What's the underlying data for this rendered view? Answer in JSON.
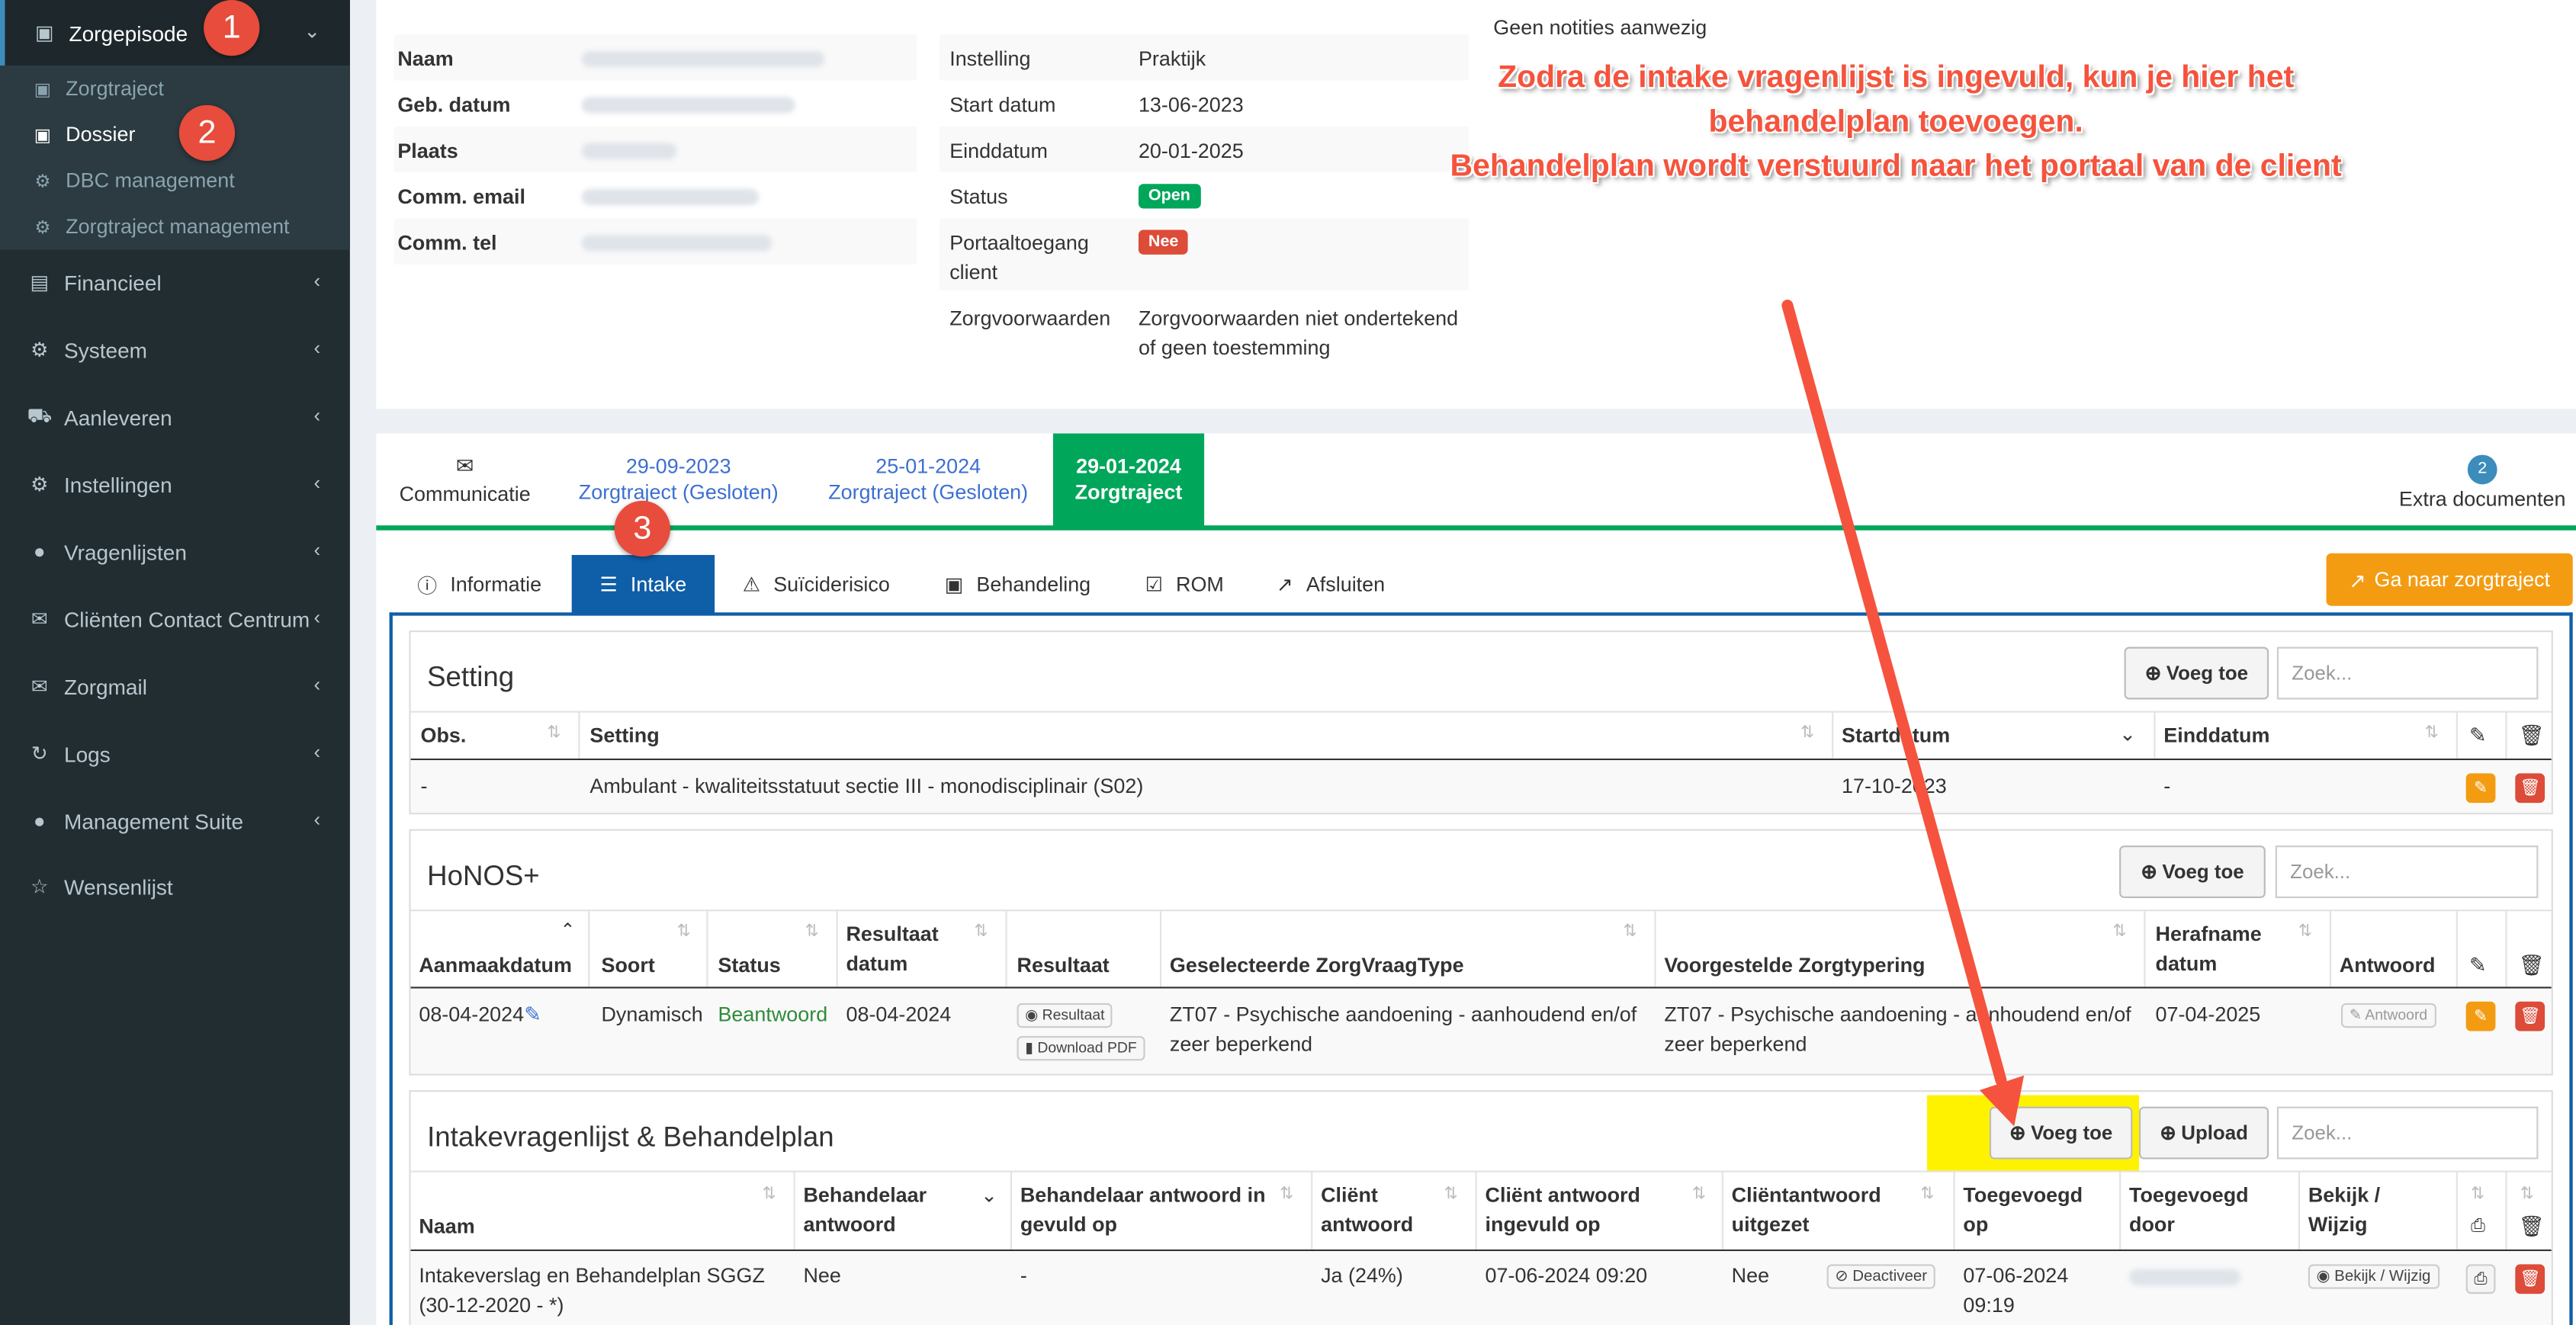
{
  "sidebar": {
    "header": "Zorgepisode",
    "subs": [
      "Zorgtraject",
      "Dossier",
      "DBC management",
      "Zorgtraject management"
    ],
    "items": [
      "Financieel",
      "Systeem",
      "Aanleveren",
      "Instellingen",
      "Vragenlijsten",
      "Cliënten Contact Centrum",
      "Zorgmail",
      "Logs",
      "Management Suite",
      "Wensenlijst"
    ]
  },
  "steps": [
    "1",
    "2",
    "3"
  ],
  "client": {
    "labels": [
      "Naam",
      "Geb. datum",
      "Plaats",
      "Comm. email",
      "Comm. tel"
    ]
  },
  "traject": {
    "rows": [
      {
        "k": "Instelling",
        "v": "Praktijk"
      },
      {
        "k": "Start datum",
        "v": "13-06-2023"
      },
      {
        "k": "Einddatum",
        "v": "20-01-2025"
      },
      {
        "k": "Status",
        "v": "Open"
      },
      {
        "k": "Portaaltoegang client",
        "v": "Nee"
      },
      {
        "k": "Zorgvoorwaarden",
        "v": "Zorgvoorwaarden niet ondertekend of geen toestemming"
      }
    ]
  },
  "notes": "Geen notities aanwezig",
  "annotation": [
    "Zodra de intake vragenlijst is ingevuld, kun je hier het",
    "behandelplan toevoegen.",
    "Behandelplan wordt verstuurd naar het portaal van de client"
  ],
  "tabs": {
    "communicatie": "Communicatie",
    "t1": {
      "date": "29-09-2023",
      "label": "Zorgtraject (Gesloten)"
    },
    "t2": {
      "date": "25-01-2024",
      "label": "Zorgtraject (Gesloten)"
    },
    "t3": {
      "date": "29-01-2024",
      "label": "Zorgtraject"
    },
    "extra_count": "2",
    "extra_label": "Extra documenten"
  },
  "subtabs": [
    "Informatie",
    "Intake",
    "Suïciderisico",
    "Behandeling",
    "ROM",
    "Afsluiten"
  ],
  "goto_button": "Ga naar zorgtraject",
  "setting": {
    "title": "Setting",
    "add": "Voeg toe",
    "search_placeholder": "Zoek...",
    "headers": [
      "Obs.",
      "Setting",
      "Startdatum",
      "Einddatum"
    ],
    "row": [
      "-",
      "Ambulant - kwaliteitsstatuut sectie III - monodisciplinair (S02)",
      "17-10-2023",
      "-"
    ]
  },
  "honos": {
    "title": "HoNOS+",
    "add": "Voeg toe",
    "search_placeholder": "Zoek...",
    "headers": [
      "Aanmaakdatum",
      "Soort",
      "Status",
      "Resultaat datum",
      "Resultaat",
      "Geselecteerde ZorgVraagType",
      "Voorgestelde Zorgtypering",
      "Herafname datum",
      "Antwoord"
    ],
    "row": {
      "date": "08-04-2024",
      "soort": "Dynamisch",
      "status": "Beantwoord",
      "res_date": "08-04-2024",
      "res_btn": "Resultaat",
      "pdf_btn": "Download PDF",
      "zvt": "ZT07 - Psychische aandoening - aanhoudend en/of zeer beperkend",
      "zt": "ZT07 - Psychische aandoening - aanhoudend en/of zeer beperkend",
      "herafname": "07-04-2025",
      "antwoord": "Antwoord"
    }
  },
  "intake": {
    "title": "Intakevragenlijst & Behandelplan",
    "add": "Voeg toe",
    "upload": "Upload",
    "search_placeholder": "Zoek...",
    "headers": [
      "Naam",
      "Behandelaar antwoord",
      "Behandelaar antwoord in gevuld op",
      "Cliënt antwoord",
      "Cliënt antwoord ingevuld op",
      "Cliëntantwoord uitgezet",
      "Toegevoegd op",
      "Toegevoegd door",
      "Bekijk / Wijzig"
    ],
    "row": {
      "naam": "Intakeverslag en Behandelplan SGGZ (30-12-2020 - *)",
      "beh": "Nee",
      "beh_op": "-",
      "client": "Ja (24%)",
      "client_op": "07-06-2024 09:20",
      "uitgezet": "Nee",
      "deact": "Deactiveer",
      "toegevoegd": "07-06-2024 09:19",
      "bekijk": "Bekijk / Wijzig"
    }
  },
  "colors": {
    "sidebar": "#222d32",
    "accent": "#3c8dbc",
    "green": "#00a65a",
    "red": "#dd4b39",
    "orange": "#f39c12",
    "highlight": "#fff200",
    "arrow": "#f5533d"
  }
}
